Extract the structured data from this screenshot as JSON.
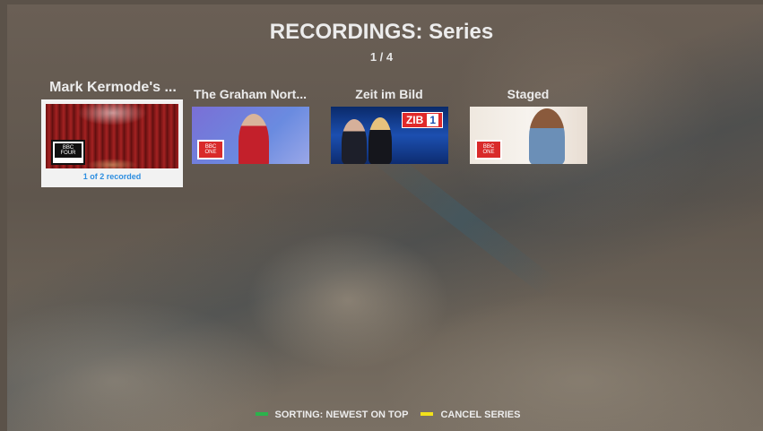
{
  "header": {
    "title": "RECORDINGS: Series",
    "pager": "1 / 4"
  },
  "series": [
    {
      "label": "Mark Kermode's ...",
      "channel": "BBC FOUR",
      "subtitle": "1 of 2 recorded",
      "thumb_icon": "theatre-curtain-thumbnail"
    },
    {
      "label": "The Graham Nort...",
      "channel": "BBC ONE",
      "thumb_icon": "graham-norton-thumbnail"
    },
    {
      "label": "Zeit im Bild",
      "channel": "ZIB 1",
      "thumb_icon": "news-studio-thumbnail"
    },
    {
      "label": "Staged",
      "channel": "BBC ONE",
      "thumb_icon": "staged-thumbnail"
    }
  ],
  "footer": {
    "green_label": "SORTING: NEWEST ON TOP",
    "yellow_label": "CANCEL SERIES",
    "green_color": "#2bb24c",
    "yellow_color": "#f2e11a"
  },
  "colors": {
    "accent": "#2d8ee0",
    "focus_frame": "#f2f2f2"
  }
}
